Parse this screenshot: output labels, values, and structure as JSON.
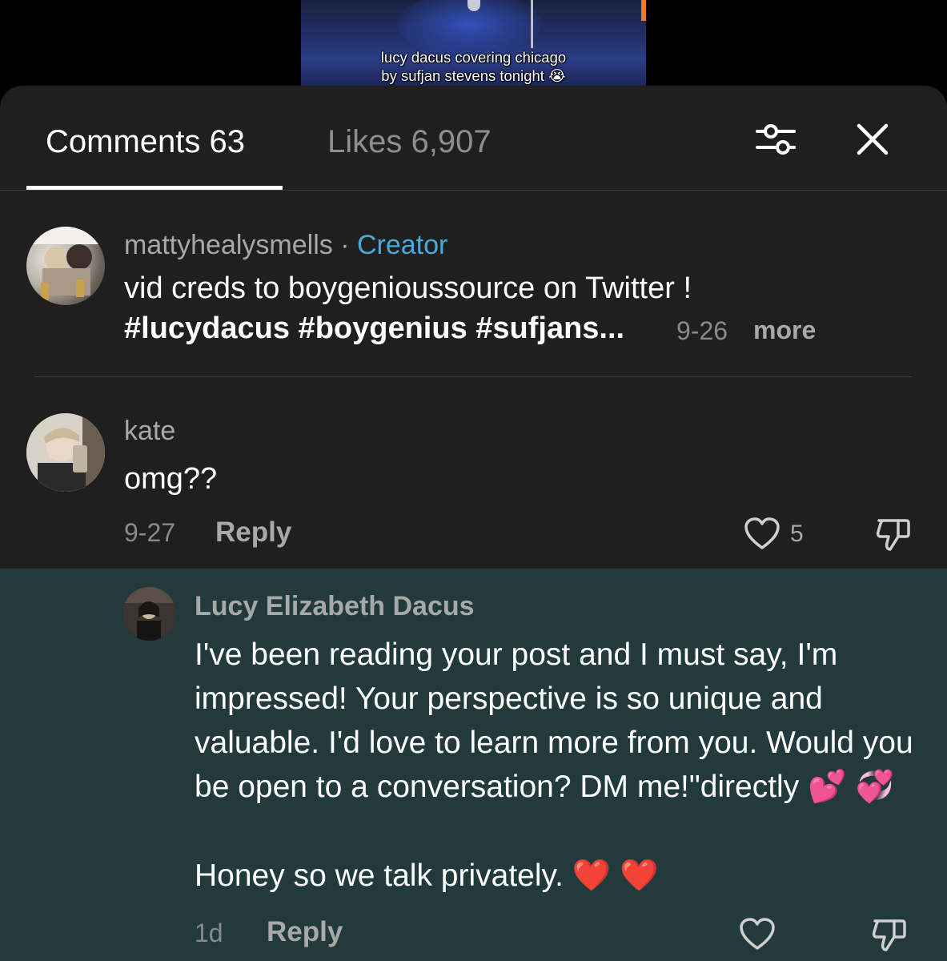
{
  "video": {
    "caption_line1": "lucy dacus covering chicago",
    "caption_line2": "by sufjan stevens tonight 😭"
  },
  "tabs": {
    "comments_label": "Comments 63",
    "likes_label": "Likes 6,907"
  },
  "icons": {
    "filter": "sliders-icon",
    "close": "close-icon",
    "like": "heart-outline-icon",
    "dislike": "thumbs-down-icon"
  },
  "comments": [
    {
      "username": "mattyhealysmells",
      "separator": " · ",
      "badge": "Creator",
      "text_line1": "vid creds to boygenioussource on Twitter !",
      "text_line2": "#lucydacus #boygenius #sufjans...",
      "date": "9-26",
      "more": "more"
    },
    {
      "username": "kate",
      "text": "omg??",
      "date": "9-27",
      "reply": "Reply",
      "likes": "5"
    }
  ],
  "reply": {
    "username": "Lucy Elizabeth Dacus",
    "text": "I've been reading your post and I must say, I'm impressed! Your perspective is so unique and valuable. I'd love to learn more from you. Would you be open to a conversation? DM me!\"directly 💕 💞",
    "last_line": "Honey so we talk privately. ❤️ ❤️",
    "date": "1d",
    "reply": "Reply"
  },
  "colors": {
    "sheet_bg": "#1f1f1f",
    "highlight_bg": "#233a3c",
    "creator_accent": "#4aa9d6"
  }
}
